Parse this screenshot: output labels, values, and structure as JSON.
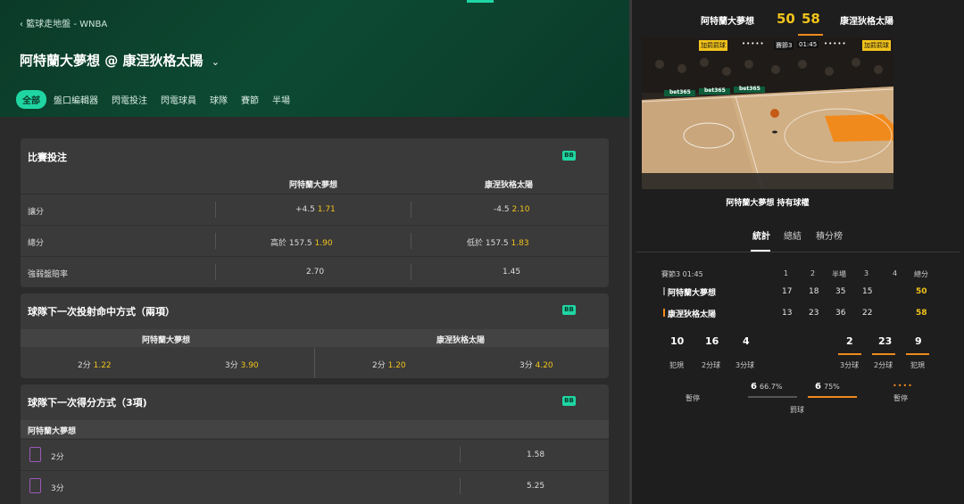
{
  "breadcrumb": "籃球走地盤 - WNBA",
  "match_title": "阿特蘭大夢想 @ 康涅狄格太陽",
  "tabs": [
    "全部",
    "盤口編輯器",
    "閃電投注",
    "閃電球員",
    "球隊",
    "賽節",
    "半場"
  ],
  "badge": "BB",
  "card1": {
    "title": "比賽投注",
    "home": "阿特蘭大夢想",
    "away": "康涅狄格太陽",
    "rows": [
      {
        "label": "讓分",
        "home_line": "+4.5",
        "home_odds": "1.71",
        "away_line": "-4.5",
        "away_odds": "2.10"
      },
      {
        "label": "總分",
        "home_line": "高於 157.5",
        "home_odds": "1.90",
        "away_line": "低於 157.5",
        "away_odds": "1.83"
      },
      {
        "label": "強弱盤賠率",
        "home_line": "",
        "home_odds": "2.70",
        "away_line": "",
        "away_odds": "1.45"
      }
    ]
  },
  "card2": {
    "title": "球隊下一次投射命中方式（兩項）",
    "home": "阿特蘭大夢想",
    "away": "康涅狄格太陽",
    "cells": [
      {
        "label": "2分",
        "odds": "1.22"
      },
      {
        "label": "3分",
        "odds": "3.90"
      },
      {
        "label": "2分",
        "odds": "1.20"
      },
      {
        "label": "3分",
        "odds": "4.20"
      }
    ]
  },
  "card3": {
    "title": "球隊下一次得分方式（3項)",
    "team": "阿特蘭大夢想",
    "rows": [
      {
        "label": "2分",
        "odds": "1.58"
      },
      {
        "label": "3分",
        "odds": "5.25"
      }
    ]
  },
  "scoreboard": {
    "home": "阿特蘭大夢想",
    "home_score": "50",
    "away_score": "58",
    "away": "康涅狄格太陽"
  },
  "court": {
    "bonus_left": "加罰罰球",
    "bonus_right": "加罰罰球",
    "quarter": "賽節3",
    "clock": "01:45",
    "ad": "bet365",
    "possession": "阿特蘭大夢想 持有球權"
  },
  "stats_tabs": [
    "統計",
    "總結",
    "積分榜"
  ],
  "table": {
    "header": [
      "賽節3 01:45",
      "1",
      "2",
      "半場",
      "3",
      "4",
      "總分"
    ],
    "rows": [
      {
        "team": "阿特蘭大夢想",
        "q1": "17",
        "q2": "18",
        "half": "35",
        "q3": "15",
        "q4": "",
        "total": "50"
      },
      {
        "team": "康涅狄格太陽",
        "q1": "13",
        "q2": "23",
        "half": "36",
        "q3": "22",
        "q4": "",
        "total": "58"
      }
    ]
  },
  "teamstats": {
    "home": [
      {
        "v": "10",
        "l": "犯規"
      },
      {
        "v": "16",
        "l": "2分球"
      },
      {
        "v": "4",
        "l": "3分球"
      }
    ],
    "away": [
      {
        "v": "2",
        "l": "3分球"
      },
      {
        "v": "23",
        "l": "2分球"
      },
      {
        "v": "9",
        "l": "犯規"
      }
    ],
    "timeout_label": "暫停",
    "ft_label": "罰球",
    "ft_home": "6",
    "ft_home_pct": "66.7%",
    "ft_away": "6",
    "ft_away_pct": "75%"
  },
  "colors": {
    "accent": "#1fd6a3",
    "odds": "#f2c31b",
    "away": "#f08a1c",
    "home": "#8a8a8a"
  }
}
